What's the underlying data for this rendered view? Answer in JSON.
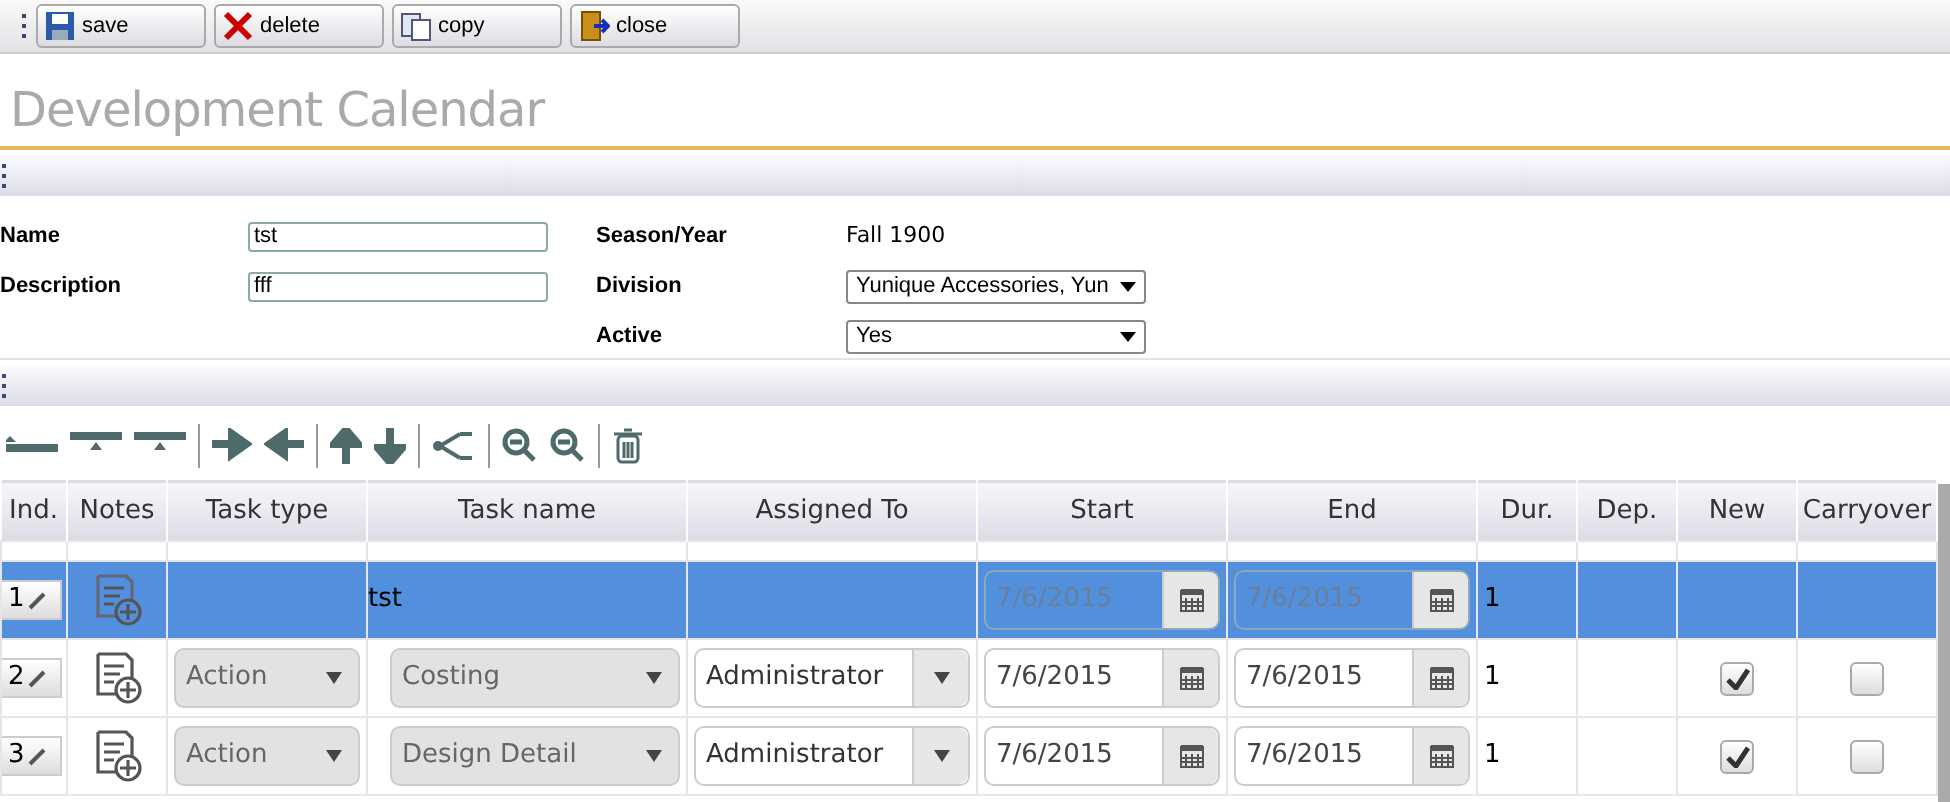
{
  "toolbar": [
    {
      "kind": "save",
      "label": "save"
    },
    {
      "kind": "delete",
      "label": "delete"
    },
    {
      "kind": "copy",
      "label": "copy"
    },
    {
      "kind": "close",
      "label": "close"
    }
  ],
  "title": "Development Calendar",
  "form": {
    "left": [
      {
        "kind": "input",
        "label": "Name",
        "value": "tst"
      },
      {
        "kind": "input",
        "label": "Description",
        "value": "fff"
      }
    ],
    "right": [
      {
        "kind": "text",
        "label": "Season/Year",
        "value": "Fall 1900"
      },
      {
        "kind": "select",
        "label": "Division",
        "value": "Yunique Accessories, Yun"
      },
      {
        "kind": "select",
        "label": "Active",
        "value": "Yes"
      }
    ]
  },
  "table": {
    "columns": [
      "Ind.",
      "Notes",
      "Task type",
      "Task name",
      "Assigned To",
      "Start",
      "End",
      "Dur.",
      "Dep.",
      "New",
      "Carryover"
    ],
    "rows": [
      {
        "index": "1",
        "selected": true,
        "task_name": "tst",
        "start": "7/6/2015",
        "end": "7/6/2015",
        "duration": "1"
      },
      {
        "index": "2",
        "selected": false,
        "task_type": "Action",
        "task_name": "Costing",
        "assigned_to": "Administrator",
        "start": "7/6/2015",
        "end": "7/6/2015",
        "duration": "1",
        "new": true,
        "carryover": false
      },
      {
        "index": "3",
        "selected": false,
        "task_type": "Action",
        "task_name": "Design Detail",
        "assigned_to": "Administrator",
        "start": "7/6/2015",
        "end": "7/6/2015",
        "duration": "1",
        "new": true,
        "carryover": false
      }
    ]
  }
}
